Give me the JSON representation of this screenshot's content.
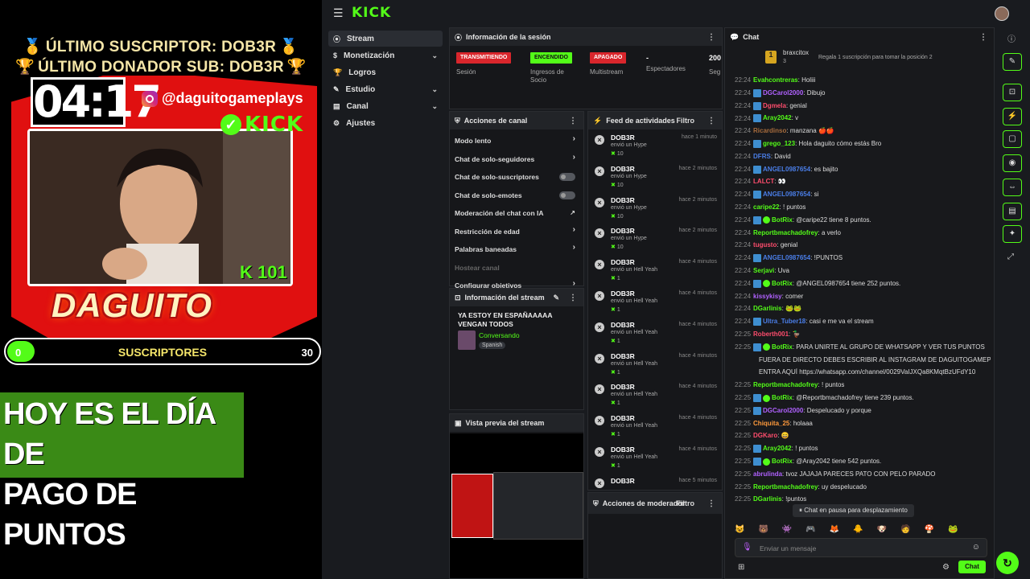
{
  "overlay": {
    "last_sub_line": "ÚLTIMO SUSCRIPTOR: DOB3R",
    "last_donor_line": "ÚLTIMO DONADOR SUB: DOB3R",
    "timer": "04:17",
    "instagram_handle": "@daguitogameplays",
    "kick_logo_text": "KICK",
    "kick_level": "K 101",
    "streamer_name": "DAGUITO",
    "sub_goal": {
      "label": "SUSCRIPTORES",
      "current": "0",
      "target": "30",
      "progress": 0
    },
    "banner_line1": "HOY ES EL DÍA DE",
    "banner_line2": "PAGO DE PUNTOS"
  },
  "dashboard": {
    "brand": "KICK",
    "sidebar": [
      {
        "label": "Stream",
        "icon": "broadcast-icon",
        "active": true
      },
      {
        "label": "Monetización",
        "icon": "money-icon",
        "chevron": true
      },
      {
        "label": "Logros",
        "icon": "trophy-icon"
      },
      {
        "label": "Estudio",
        "icon": "studio-icon",
        "chevron": true
      },
      {
        "label": "Canal",
        "icon": "channel-icon",
        "chevron": true
      },
      {
        "label": "Ajustes",
        "icon": "gear-icon"
      }
    ],
    "session": {
      "title": "Información de la sesión",
      "stats": [
        {
          "badge": "TRANSMITIENDO",
          "color": "#d9262c",
          "sub": "Sesión"
        },
        {
          "badge": "ENCENDIDO",
          "color": "#53fc18",
          "sub": "Ingresos de Socio"
        },
        {
          "badge": "APAGADO",
          "color": "#d9262c",
          "sub": "Multistream"
        },
        {
          "badge": "-",
          "color": "",
          "sub": "Espectadores"
        },
        {
          "badge": "200",
          "color": "",
          "sub": "Seg"
        }
      ]
    },
    "channel_actions": {
      "title": "Acciones de canal",
      "items": [
        {
          "label": "Modo lento",
          "type": "arrow"
        },
        {
          "label": "Chat de solo-seguidores",
          "type": "arrow"
        },
        {
          "label": "Chat de solo-suscriptores",
          "type": "toggle"
        },
        {
          "label": "Chat de solo-emotes",
          "type": "toggle"
        },
        {
          "label": "Moderación del chat con IA",
          "type": "ext"
        },
        {
          "label": "Restricción de edad",
          "type": "arrow"
        },
        {
          "label": "Palabras baneadas",
          "type": "arrow"
        },
        {
          "label": "Hostear canal",
          "type": "none"
        },
        {
          "label": "Configurar objetivos",
          "type": "arrow"
        }
      ]
    },
    "stream_info": {
      "title": "Información del stream",
      "stream_title": "YA ESTOY EN ESPAÑAAAAA VENGAN TODOS",
      "category": "Conversando",
      "language": "Spanish"
    },
    "preview": {
      "title": "Vista previa del stream"
    },
    "activity": {
      "title": "Feed de actividades",
      "filter": "Filtro",
      "items": [
        {
          "name": "DOB3R",
          "sent": "envió un Hype",
          "amount": "10",
          "time": "hace 1 minuto"
        },
        {
          "name": "DOB3R",
          "sent": "envió un Hype",
          "amount": "10",
          "time": "hace 2 minutos"
        },
        {
          "name": "DOB3R",
          "sent": "envió un Hype",
          "amount": "10",
          "time": "hace 2 minutos"
        },
        {
          "name": "DOB3R",
          "sent": "envió un Hype",
          "amount": "10",
          "time": "hace 2 minutos"
        },
        {
          "name": "DOB3R",
          "sent": "envió un Hell Yeah",
          "amount": "1",
          "time": "hace 4 minutos"
        },
        {
          "name": "DOB3R",
          "sent": "envió un Hell Yeah",
          "amount": "1",
          "time": "hace 4 minutos"
        },
        {
          "name": "DOB3R",
          "sent": "envió un Hell Yeah",
          "amount": "1",
          "time": "hace 4 minutos"
        },
        {
          "name": "DOB3R",
          "sent": "envió un Hell Yeah",
          "amount": "1",
          "time": "hace 4 minutos"
        },
        {
          "name": "DOB3R",
          "sent": "envió un Hell Yeah",
          "amount": "1",
          "time": "hace 4 minutos"
        },
        {
          "name": "DOB3R",
          "sent": "envió un Hell Yeah",
          "amount": "1",
          "time": "hace 4 minutos"
        },
        {
          "name": "DOB3R",
          "sent": "envió un Hell Yeah",
          "amount": "1",
          "time": "hace 4 minutos"
        },
        {
          "name": "DOB3R",
          "sent": "",
          "amount": "",
          "time": "hace 5 minutos"
        }
      ]
    },
    "moderator": {
      "title": "Acciones de moderador",
      "filter": "Filtro"
    },
    "chat": {
      "title": "Chat",
      "pinned_user": "braxcitox",
      "pinned_count": "3",
      "gift_hint": "Regala 1 suscripción para tomar la posición 2",
      "paused": "Chat en pausa para desplazamiento",
      "placeholder": "Enviar un mensaje",
      "send": "Chat",
      "messages": [
        {
          "t": "22:24",
          "u": "Evahcontreras",
          "c": "#53fc18",
          "m": "Holiii"
        },
        {
          "t": "22:24",
          "u": "DGCarol2000",
          "c": "#b061ff",
          "m": "Dibujo",
          "b": true
        },
        {
          "t": "22:24",
          "u": "Dgmela",
          "c": "#ff4d6d",
          "m": "genial",
          "b": true
        },
        {
          "t": "22:24",
          "u": "Aray2042",
          "c": "#53fc18",
          "m": "v",
          "b": true
        },
        {
          "t": "22:24",
          "u": "Ricardinso",
          "c": "#a66b3c",
          "m": "manzana 🍎🍎"
        },
        {
          "t": "22:24",
          "u": "grego_123",
          "c": "#53fc18",
          "m": "Hola daguito cómo estás Bro",
          "b": true
        },
        {
          "t": "22:24",
          "u": "DFRS",
          "c": "#4a7ee8",
          "m": "David"
        },
        {
          "t": "22:24",
          "u": "ANGEL0987654",
          "c": "#4a7ee8",
          "m": "es bajito",
          "b": true
        },
        {
          "t": "22:24",
          "u": "LALCT",
          "c": "#ff4d6d",
          "m": "👀"
        },
        {
          "t": "22:24",
          "u": "ANGEL0987654",
          "c": "#4a7ee8",
          "m": "si",
          "b": true
        },
        {
          "t": "22:24",
          "u": "caripe22",
          "c": "#53fc18",
          "m": "! puntos"
        },
        {
          "t": "22:24",
          "u": "BotRix",
          "c": "#53fc18",
          "m": "@caripe22 tiene 8 puntos.",
          "b": true,
          "ok": true
        },
        {
          "t": "22:24",
          "u": "Reportbmachadofrey",
          "c": "#53fc18",
          "m": "a verlo"
        },
        {
          "t": "22:24",
          "u": "tugusto",
          "c": "#ff4d6d",
          "m": "genial"
        },
        {
          "t": "22:24",
          "u": "ANGEL0987654",
          "c": "#4a7ee8",
          "m": "!PUNTOS",
          "b": true
        },
        {
          "t": "22:24",
          "u": "Serjavi",
          "c": "#53fc18",
          "m": "Uva"
        },
        {
          "t": "22:24",
          "u": "BotRix",
          "c": "#53fc18",
          "m": "@ANGEL0987654 tiene 252 puntos.",
          "b": true,
          "ok": true
        },
        {
          "t": "22:24",
          "u": "kissykisy",
          "c": "#b061ff",
          "m": "comer"
        },
        {
          "t": "22:24",
          "u": "DGarlinis",
          "c": "#53fc18",
          "m": "🐸🐸"
        },
        {
          "t": "22:24",
          "u": "Ultra_Tuber18",
          "c": "#4a7ee8",
          "m": "casi e me va el stream",
          "b": true
        },
        {
          "t": "22:25",
          "u": "Roberth001",
          "c": "#ff4d6d",
          "m": "🦆"
        },
        {
          "t": "22:25",
          "u": "BotRix",
          "c": "#53fc18",
          "m": "PARA UNIRTE AL GRUPO DE WHATSAPP Y VER TUS PUNTOS",
          "b": true,
          "ok": true
        },
        {
          "t": "",
          "u": "",
          "c": "#ddd",
          "m": "FUERA DE DIRECTO DEBES ESCRIBIR AL INSTAGRAM DE DAGUITOGAMEPLAYS O"
        },
        {
          "t": "",
          "u": "",
          "c": "#ddd",
          "m": "ENTRA AQUÍ https://whatsapp.com/channel/0029VaIJXQa8KMqtBzUFdY10"
        },
        {
          "t": "22:25",
          "u": "Reportbmachadofrey",
          "c": "#53fc18",
          "m": "! puntos"
        },
        {
          "t": "22:25",
          "u": "BotRix",
          "c": "#53fc18",
          "m": "@Reportbmachadofrey tiene 239 puntos.",
          "b": true,
          "ok": true
        },
        {
          "t": "22:25",
          "u": "DGCarol2000",
          "c": "#b061ff",
          "m": "Despelucado y porque",
          "b": true
        },
        {
          "t": "22:25",
          "u": "Chiquita_25",
          "c": "#ff9a3c",
          "m": "holaaa"
        },
        {
          "t": "22:25",
          "u": "DGKaro",
          "c": "#ff4d6d",
          "m": "😄"
        },
        {
          "t": "22:25",
          "u": "Aray2042",
          "c": "#53fc18",
          "m": "! puntos",
          "b": true
        },
        {
          "t": "22:25",
          "u": "BotRix",
          "c": "#53fc18",
          "m": "@Aray2042 tiene 542 puntos.",
          "b": true,
          "ok": true
        },
        {
          "t": "22:25",
          "u": "abrulinda",
          "c": "#b061ff",
          "m": "tvoz JAJAJA PARECES PATO CON PELO PARADO"
        },
        {
          "t": "22:25",
          "u": "Reportbmachadofrey",
          "c": "#53fc18",
          "m": "uy despelucado"
        },
        {
          "t": "22:25",
          "u": "DGarlinis",
          "c": "#53fc18",
          "m": "!puntos"
        }
      ]
    }
  }
}
